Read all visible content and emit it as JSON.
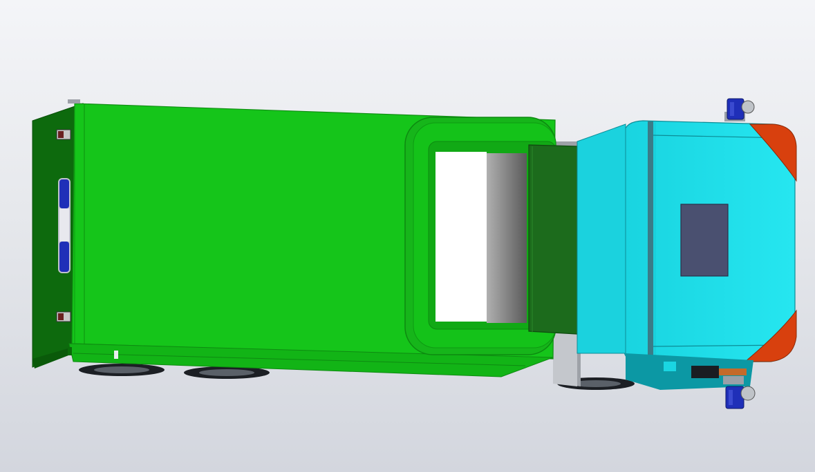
{
  "scene": {
    "background_top": "#f4f5f8",
    "background_bottom": "#d3d6de"
  },
  "model": {
    "colors": {
      "box_green": "#15c51a",
      "box_dark_green": "#0d6a0d",
      "door_green": "#1c6b1c",
      "cab_cyan": "#22e4ee",
      "cab_dark_cyan": "#0d9aa6",
      "corner_orange": "#d8400e",
      "window_slate": "#4a5070",
      "beacon_blue": "#1f2fb8",
      "opening_white": "#ffffff",
      "opening_gray": "#6f6f6f",
      "tire_dark": "#1c1f24"
    },
    "icons": [
      "beacon-light-icon",
      "mirror-icon",
      "wheel-icon",
      "rear-light-icon"
    ]
  }
}
